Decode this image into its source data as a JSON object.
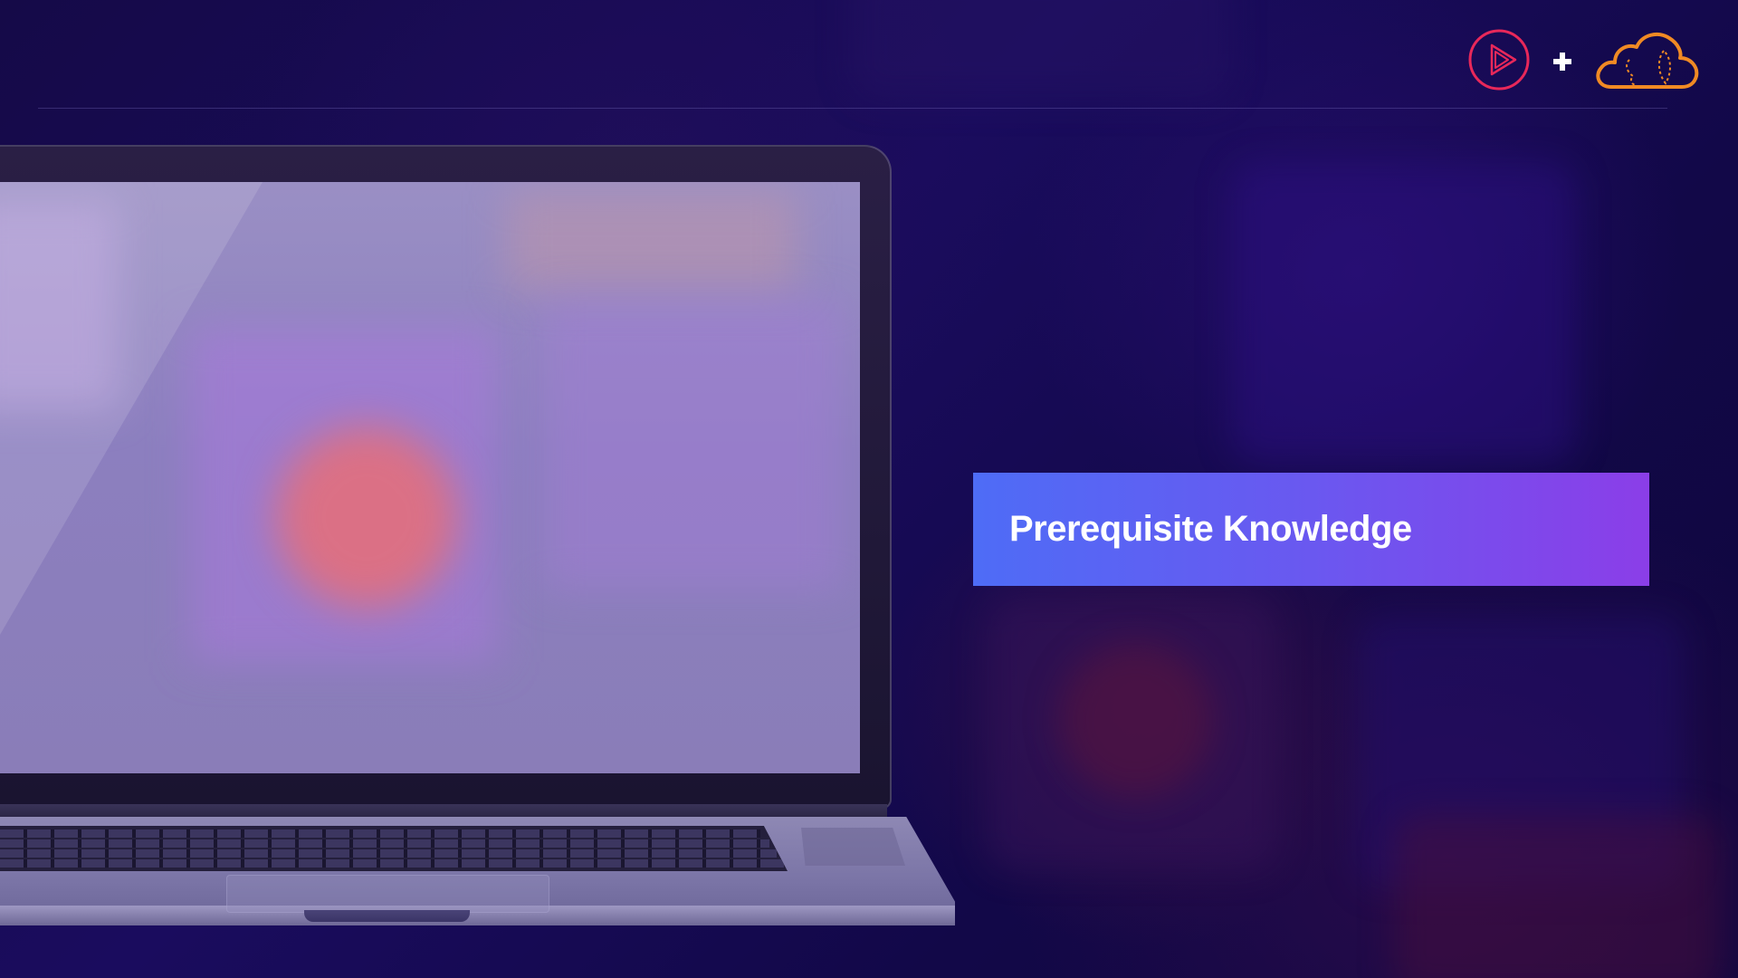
{
  "slide": {
    "title": "Prerequisite Knowledge"
  },
  "header": {
    "logos": [
      "play-circle-icon",
      "plus-icon",
      "cloud-icon"
    ]
  },
  "colors": {
    "background": "#150a48",
    "banner_start": "#4e6cf6",
    "banner_end": "#8b3ee8",
    "play_logo": "#e8285a",
    "cloud_logo": "#f08a24"
  }
}
